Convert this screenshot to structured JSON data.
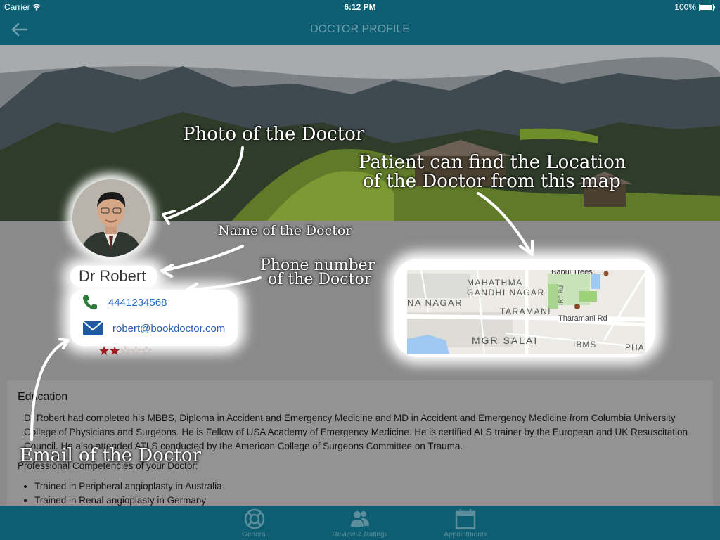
{
  "status_bar": {
    "carrier": "Carrier",
    "time": "6:12 PM",
    "battery": "100%"
  },
  "nav": {
    "title": "DOCTOR PROFILE"
  },
  "doctor": {
    "name": "Dr Robert",
    "phone": "4441234568",
    "email": "robert@bookdoctor.com",
    "rating": 2,
    "rating_max": 5
  },
  "map_labels": {
    "babul_trees": "Babul Trees",
    "mahathma": "MAHATHMA",
    "gandhi_nagar": "GANDHI NAGAR",
    "irt_rd": "IRT Rd",
    "na_nagar": "NA NAGAR",
    "taramani": "TARAMANI",
    "taramani_rd": "Tharamani Rd",
    "mgr_salai": "MGR SALAI",
    "ibms": "IBMS",
    "pha": "PHA"
  },
  "education": {
    "title": "Education",
    "text": "Dr Robert had completed his MBBS, Diploma in Accident and Emergency Medicine and MD in Accident and Emergency Medicine from Columbia University College of Physicians and Surgeons. He is Fellow of USA Academy of Emergency Medicine. He is certified ALS trainer by the European and UK Resuscitation Council. He also attended ATLS conducted by the American College of Surgeons Committee on Trauma."
  },
  "competencies": {
    "title": "Professional Competencies of your Doctor:",
    "items": [
      "Trained in Peripheral angioplasty in Australia",
      "Trained in Renal angioplasty in Germany"
    ]
  },
  "tabs": [
    {
      "label": "General",
      "icon": "lifebuoy-icon"
    },
    {
      "label": "Review & Ratings",
      "icon": "users-icon"
    },
    {
      "label": "Appointments",
      "icon": "calendar-icon"
    }
  ],
  "annotations": {
    "photo": "Photo of the Doctor",
    "location_line1": "Patient can find the Location",
    "location_line2": "of the Doctor from this map",
    "name": "Name of the Doctor",
    "phone_line1": "Phone number",
    "phone_line2": "of the Doctor",
    "email": "Email of the Doctor"
  },
  "colors": {
    "bar": "#0d5e73",
    "link": "#2a6fc9",
    "star": "#a01c1c"
  }
}
